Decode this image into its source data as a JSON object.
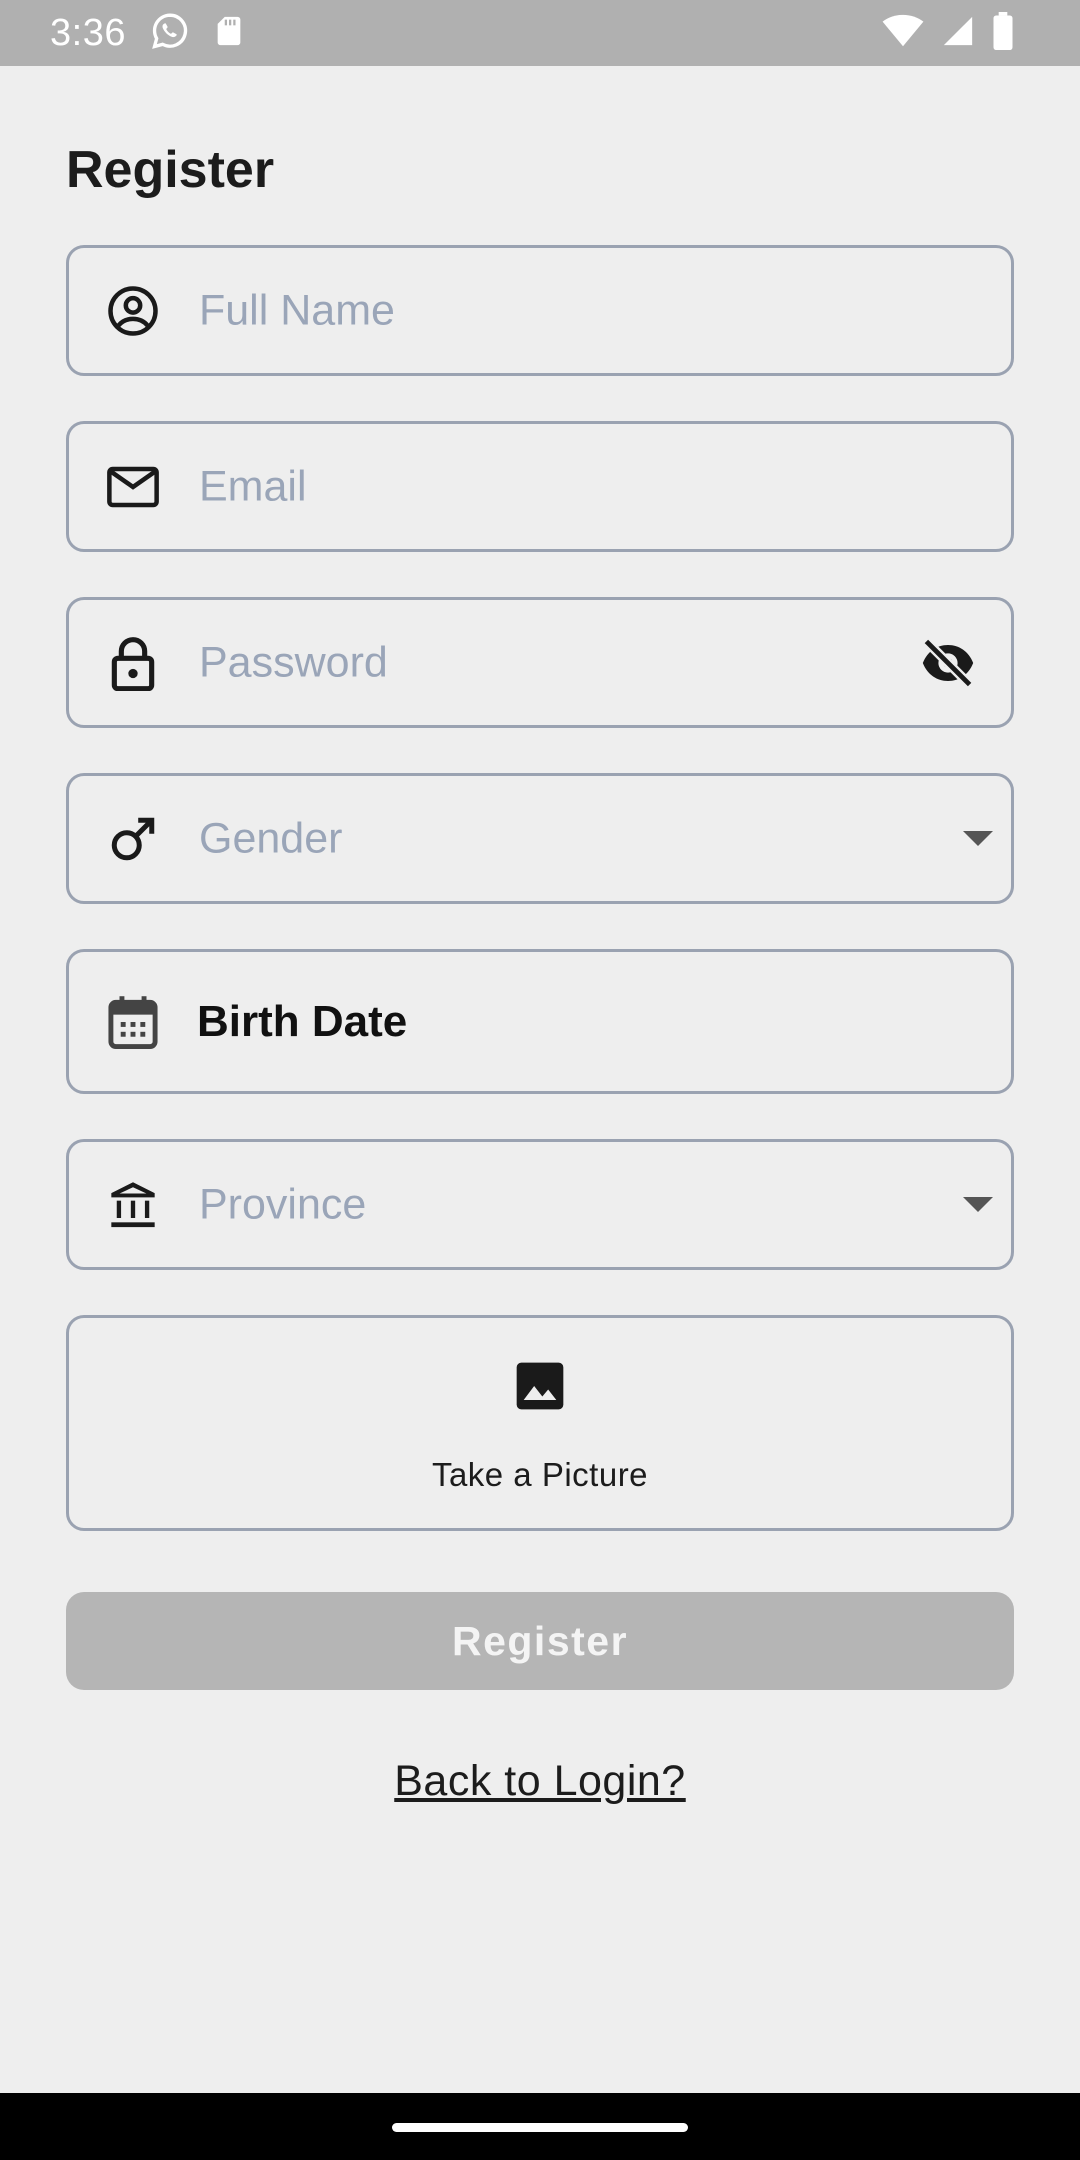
{
  "status_bar": {
    "time": "3:36",
    "icons": [
      "whatsapp-icon",
      "sd-card-icon",
      "wifi-icon",
      "signal-icon",
      "battery-icon"
    ],
    "background": "#b0b0b0"
  },
  "page": {
    "title": "Register"
  },
  "form": {
    "full_name": {
      "placeholder": "Full Name",
      "icon": "person-circle-icon"
    },
    "email": {
      "placeholder": "Email",
      "icon": "mail-icon"
    },
    "password": {
      "placeholder": "Password",
      "icon": "lock-icon",
      "trailing_icon": "visibility-off-icon"
    },
    "gender": {
      "placeholder": "Gender",
      "icon": "male-icon",
      "trailing_icon": "dropdown-arrow-icon"
    },
    "birth_date": {
      "value": "Birth Date",
      "icon": "calendar-icon"
    },
    "province": {
      "placeholder": "Province",
      "icon": "bank-icon",
      "trailing_icon": "dropdown-arrow-icon"
    },
    "picture": {
      "label": "Take a Picture",
      "icon": "image-icon"
    }
  },
  "actions": {
    "register_label": "Register",
    "back_to_login_label": "Back to Login?"
  },
  "colors": {
    "background": "#eeeeee",
    "field_border": "#9aa2b1",
    "placeholder": "#9aa5b8",
    "button_disabled": "#b5b5b5"
  }
}
